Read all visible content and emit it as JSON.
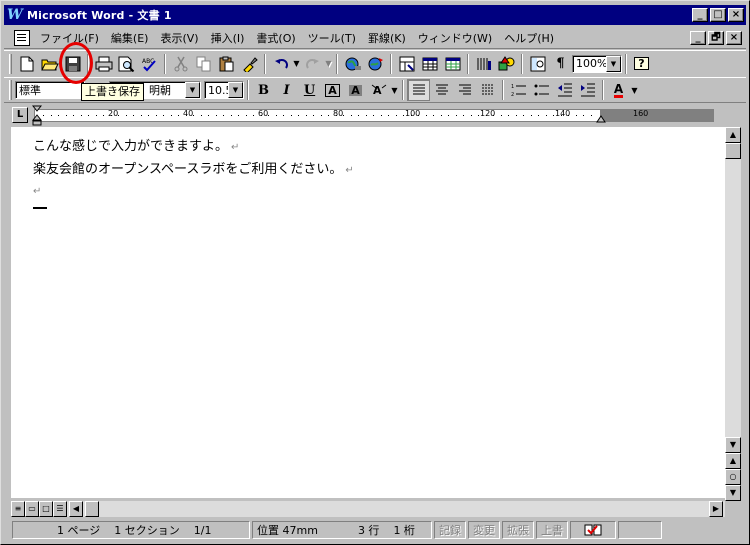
{
  "window": {
    "title": "Microsoft Word - 文書 1",
    "minimize": "_",
    "maximize": "□",
    "close": "×",
    "doc_restore": "🗗"
  },
  "menu": {
    "items": [
      "ファイル(F)",
      "編集(E)",
      "表示(V)",
      "挿入(I)",
      "書式(O)",
      "ツール(T)",
      "罫線(K)",
      "ウィンドウ(W)",
      "ヘルプ(H)"
    ]
  },
  "toolbar": {
    "zoom": "100%",
    "style": "標準",
    "font": "明朝",
    "font_size": "10.5",
    "help": "?",
    "bold": "B",
    "italic": "I",
    "underline": "U",
    "font_color": "A",
    "save_tooltip": "上書き保存"
  },
  "ruler": {
    "tab_selector": "L",
    "labels": [
      "20",
      "40",
      "60",
      "80",
      "100",
      "120",
      "140",
      "160"
    ]
  },
  "document": {
    "lines": [
      "こんな感じで入力ができますよ。",
      "楽友会館のオープンスペースラボをご利用ください。",
      ""
    ],
    "paragraph_mark": "↵"
  },
  "status": {
    "page": "1 ページ",
    "section": "1 セクション",
    "pages": "1/1",
    "position": "位置 47mm",
    "line": "3 行",
    "column": "1 桁",
    "rec": "記録",
    "trk": "変更",
    "ext": "拡張",
    "ovr": "上書"
  }
}
